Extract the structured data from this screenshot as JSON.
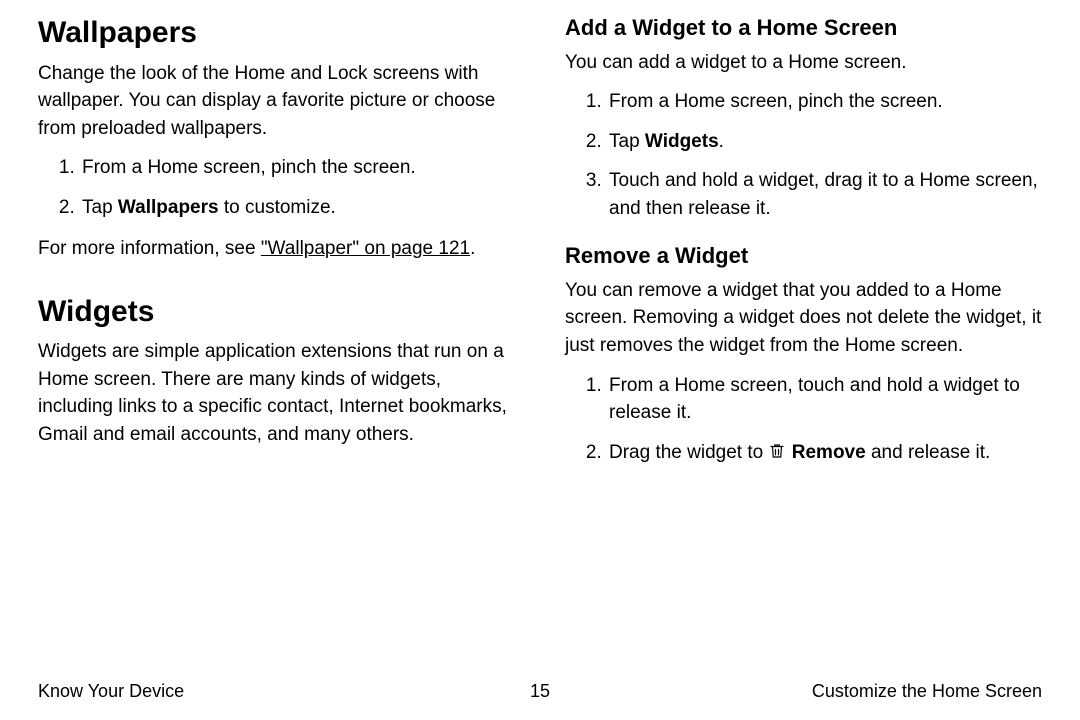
{
  "left": {
    "wallpapers": {
      "heading": "Wallpapers",
      "intro": "Change the look of the Home and Lock screens with wallpaper. You can display a favorite picture or choose from preloaded wallpapers.",
      "steps": {
        "s1": "From a Home screen, pinch the screen.",
        "s2_prefix": "Tap ",
        "s2_bold": "Wallpapers",
        "s2_suffix": " to customize."
      },
      "more_prefix": "For more information, see ",
      "more_link": "\"Wallpaper\" on page 121",
      "more_suffix": "."
    },
    "widgets": {
      "heading": "Widgets",
      "intro": "Widgets are simple application extensions that run on a Home screen. There are many kinds of widgets, including links to a specific contact, Internet bookmarks, Gmail and email accounts, and many others."
    }
  },
  "right": {
    "add": {
      "heading": "Add a Widget to a Home Screen",
      "intro": "You can add a widget to a Home screen.",
      "steps": {
        "s1": "From a Home screen, pinch the screen.",
        "s2_prefix": "Tap ",
        "s2_bold": "Widgets",
        "s2_suffix": ".",
        "s3": "Touch and hold a widget, drag it to a Home screen, and then release it."
      }
    },
    "remove": {
      "heading": "Remove a Widget",
      "intro": "You can remove a widget that you added to a Home screen. Removing a widget does not delete the widget, it just removes the widget from the Home screen.",
      "steps": {
        "s1": "From a Home screen, touch and hold a widget to release it.",
        "s2_prefix": "Drag the widget to ",
        "s2_bold": "Remove",
        "s2_suffix": " and release it."
      }
    }
  },
  "footer": {
    "left": "Know Your Device",
    "center": "15",
    "right": "Customize the Home Screen"
  }
}
